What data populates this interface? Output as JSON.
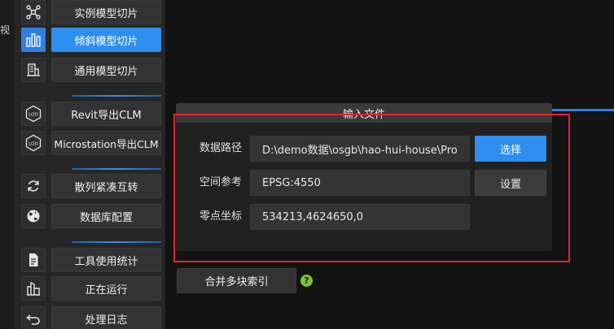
{
  "edge_strip": {
    "text": "视"
  },
  "sidebar": {
    "groups": [
      {
        "items": [
          {
            "label": "实例模型切片",
            "icon": "nodes-icon",
            "active": false
          },
          {
            "label": "倾斜模型切片",
            "icon": "bar-chart-icon",
            "active": true
          },
          {
            "label": "通用模型切片",
            "icon": "building-icon",
            "active": false
          }
        ]
      },
      {
        "items": [
          {
            "label": "Revit导出CLM",
            "icon": "lod-icon",
            "lod": "LOD",
            "active": false
          },
          {
            "label": "Microstation导出CLM",
            "icon": "lod-icon",
            "lod": "LOD",
            "active": false
          }
        ]
      },
      {
        "items": [
          {
            "label": "散列紧凑互转",
            "icon": "refresh-icon",
            "active": false
          },
          {
            "label": "数据库配置",
            "icon": "globe-icon",
            "active": false
          }
        ]
      },
      {
        "items": [
          {
            "label": "工具使用统计",
            "icon": "document-icon",
            "active": false
          },
          {
            "label": "正在运行",
            "icon": "city-icon",
            "active": false
          },
          {
            "label": "处理日志",
            "icon": "return-icon",
            "active": false
          }
        ]
      }
    ]
  },
  "input_panel": {
    "title": "输入文件",
    "fields": [
      {
        "label": "数据路径",
        "value": "D:\\demo数据\\osgb\\hao-hui-house\\Production",
        "button": "选择"
      },
      {
        "label": "空间参考",
        "value": "EPSG:4550",
        "button": "设置"
      },
      {
        "label": "零点坐标",
        "value": "534213,4624650,0"
      }
    ]
  },
  "merge": {
    "label": "合并多块索引",
    "help": "?"
  },
  "colors": {
    "accent": "#2f8ff0",
    "highlight_border": "#e0232e",
    "help_green": "#7cc52a",
    "sidebar_bg": "#262626",
    "main_bg": "#131313"
  }
}
